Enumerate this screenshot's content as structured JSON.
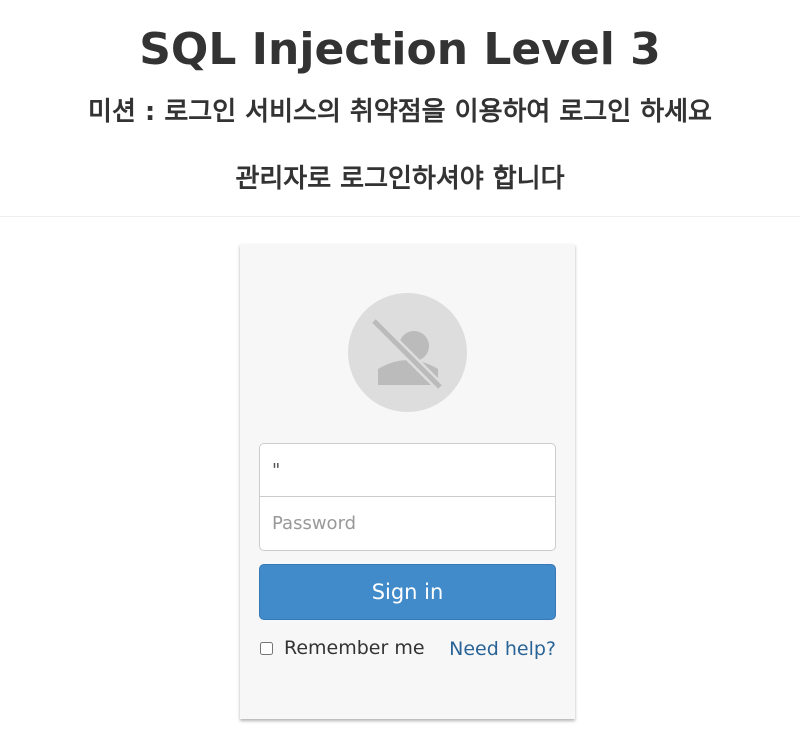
{
  "header": {
    "title": "SQL Injection Level 3",
    "mission": "미션 : 로그인 서비스의 취약점을 이용하여 로그인 하세요",
    "mission_sub": "관리자로 로그인하셔야 합니다"
  },
  "login": {
    "avatar_icon": "no-user-icon",
    "username_value": "\"",
    "password_placeholder": "Password",
    "signin_label": "Sign in",
    "remember_label": "Remember me",
    "remember_checked": false,
    "help_label": "Need help?"
  },
  "colors": {
    "primary_button": "#428bca",
    "link": "#2a6496",
    "card_background": "#f7f7f7",
    "avatar_background": "#dddddd",
    "avatar_glyph": "#bbbbbb"
  }
}
